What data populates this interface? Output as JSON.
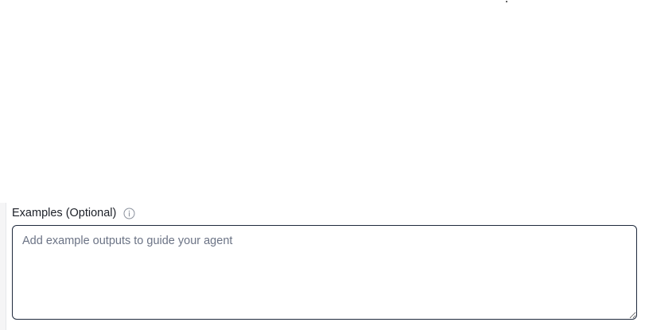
{
  "examples_field": {
    "label": "Examples (Optional)",
    "info_icon": "info-circle-icon",
    "placeholder": "Add example outputs to guide your agent",
    "value": ""
  },
  "colors": {
    "border": "#1f2a3d",
    "label": "#1b1f27",
    "placeholder": "#6b7385",
    "icon": "#8a909c"
  }
}
